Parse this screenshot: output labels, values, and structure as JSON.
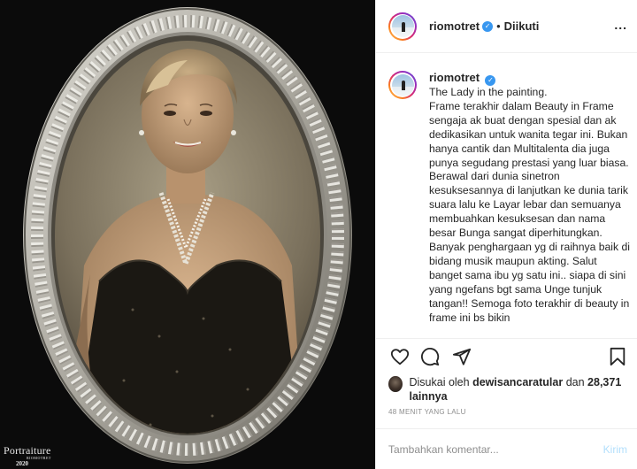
{
  "post": {
    "watermark": {
      "main": "Portraiture",
      "sub": "RIOMOTRET",
      "year": "2020"
    }
  },
  "header": {
    "username": "riomotret",
    "verified_glyph": "✓",
    "separator": "•",
    "follow_state": "Diikuti",
    "more_glyph": "..."
  },
  "caption": {
    "username": "riomotret",
    "text": "The Lady in the painting.\nFrame terakhir dalam Beauty in Frame sengaja ak buat dengan spesial dan ak dedikasikan untuk wanita tegar ini. Bukan hanya cantik dan Multitalenta dia juga punya segudang prestasi yang luar biasa. Berawal dari dunia sinetron kesuksesannya di lanjutkan ke dunia tarik suara lalu ke Layar lebar dan semuanya membuahkan kesuksesan dan nama besar Bunga sangat diperhitungkan. Banyak penghargaan yg di raihnya baik di bidang musik maupun akting. Salut banget sama ibu yg satu ini.. siapa di sini yang ngefans bgt sama Unge tunjuk tangan!! Semoga foto terakhir di beauty in frame ini bs bikin"
  },
  "actions": {
    "icons": [
      "heart-icon",
      "comment-icon",
      "share-icon",
      "bookmark-icon"
    ]
  },
  "likes": {
    "prefix": "Disukai oleh",
    "liker": "dewisancaratular",
    "connector": "dan",
    "others": "28,371 lainnya"
  },
  "timestamp": "48 MENIT YANG LALU",
  "comment": {
    "placeholder": "Tambahkan komentar...",
    "send_label": "Kirim"
  },
  "colors": {
    "accent": "#3897f0",
    "send_disabled": "#b2dffc",
    "muted": "#8e8e8e",
    "photo_background": "#0b0b0b",
    "frame_silver": "#b9b7b0"
  }
}
